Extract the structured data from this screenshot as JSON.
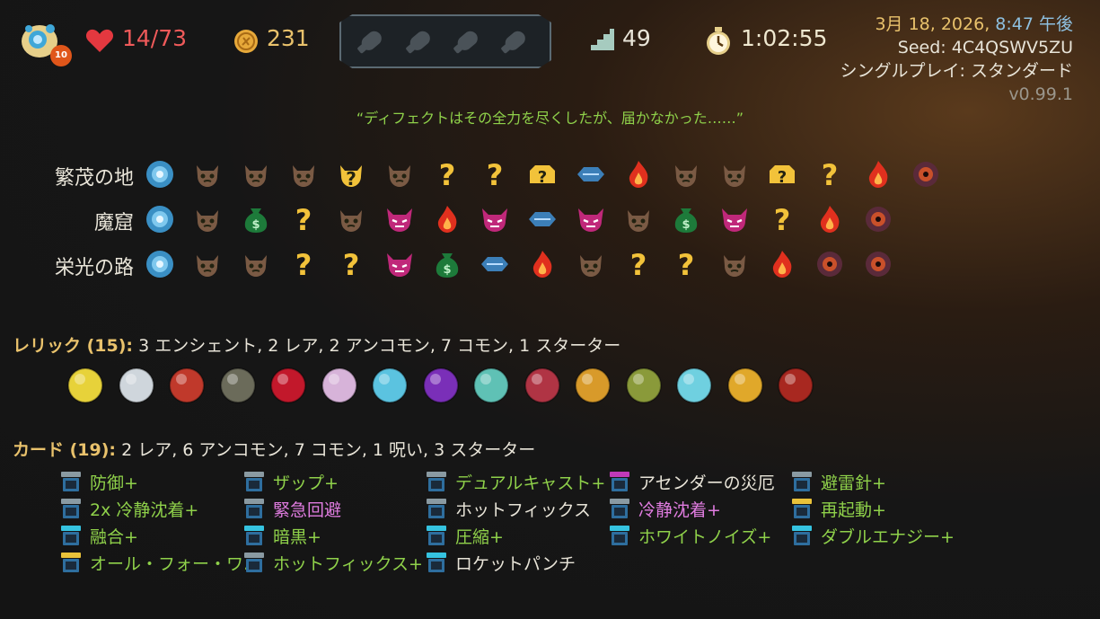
{
  "header": {
    "ascension": "10",
    "hp": "14/73",
    "gold": "231",
    "floor": "49",
    "time": "1:02:55",
    "date": "3月 18, 2026, ",
    "clock": "8:47 午後",
    "seed": "Seed: 4C4QSWV5ZU",
    "mode": "シングルプレイ: スタンダード",
    "version": "v0.99.1",
    "potion_slots": [
      "potion-slot-empty",
      "potion-slot-empty",
      "potion-slot-empty",
      "potion-slot-empty"
    ]
  },
  "quote": "“ディフェクトはその全力を尽くしたが、届かなかった……”",
  "acts": [
    {
      "label": "繁茂の地",
      "nodes": [
        "ancient",
        "monster",
        "monster",
        "monster",
        "unknown-monster",
        "monster",
        "unknown",
        "unknown",
        "unknown-treasure",
        "treasure",
        "rest",
        "monster",
        "monster",
        "unknown-treasure",
        "unknown",
        "rest",
        "boss"
      ]
    },
    {
      "label": "魔窟",
      "nodes": [
        "ancient",
        "monster",
        "shop",
        "unknown",
        "monster",
        "elite",
        "rest",
        "elite",
        "treasure",
        "elite",
        "monster",
        "shop",
        "elite",
        "unknown",
        "rest",
        "boss"
      ]
    },
    {
      "label": "栄光の路",
      "nodes": [
        "ancient",
        "monster",
        "monster",
        "unknown",
        "unknown",
        "elite",
        "shop",
        "treasure",
        "rest",
        "monster",
        "unknown",
        "unknown",
        "monster",
        "rest",
        "boss",
        "boss"
      ]
    }
  ],
  "relics": {
    "heading": "レリック (15):",
    "summary": " 3 エンシェント, 2 レア, 2 アンコモン, 7 コモン, 1 スターター",
    "items": [
      "lightning-orb",
      "glass-orb",
      "lipstick",
      "dragon-egg",
      "red-envelope",
      "worm",
      "ice-crystal",
      "purple-flame",
      "ticket",
      "anvil",
      "sunflower-pot",
      "fern",
      "gem-pendant",
      "golden-crown",
      "potion-flask"
    ]
  },
  "cards": {
    "heading": "カード (19):",
    "summary": " 2 レア, 6 アンコモン, 7 コモン, 1 呪い, 3 スターター",
    "items": [
      {
        "name": "防御+",
        "style": "up",
        "icon": "card-skill"
      },
      {
        "name": "2x 冷静沈着+",
        "style": "up",
        "icon": "card-skill"
      },
      {
        "name": "融合+",
        "style": "up",
        "icon": "card-skill-rare"
      },
      {
        "name": "オール・フォー・ワ…",
        "style": "up",
        "icon": "card-skill-gold"
      },
      {
        "name": "ザップ+",
        "style": "up",
        "icon": "card-skill"
      },
      {
        "name": "緊急回避",
        "style": "pink",
        "icon": "card-skill-blue"
      },
      {
        "name": "暗黒+",
        "style": "up",
        "icon": "card-skill-rare"
      },
      {
        "name": "ホットフィックス+",
        "style": "up",
        "icon": "card-skill"
      },
      {
        "name": "デュアルキャスト+",
        "style": "up",
        "icon": "card-skill"
      },
      {
        "name": "ホットフィックス",
        "style": "norm",
        "icon": "card-skill"
      },
      {
        "name": "圧縮+",
        "style": "up",
        "icon": "card-skill-rare"
      },
      {
        "name": "ロケットパンチ",
        "style": "norm",
        "icon": "card-skill-rare"
      },
      {
        "name": "アセンダーの災厄",
        "style": "norm",
        "icon": "card-curse"
      },
      {
        "name": "冷静沈着+",
        "style": "pink",
        "icon": "card-skill-white"
      },
      {
        "name": "ホワイトノイズ+",
        "style": "up",
        "icon": "card-skill-rare"
      },
      {
        "name": "避雷針+",
        "style": "up",
        "icon": "card-skill"
      },
      {
        "name": "再起動+",
        "style": "up",
        "icon": "card-skill-gold"
      },
      {
        "name": "ダブルエナジー+",
        "style": "up",
        "icon": "card-skill-rare"
      }
    ]
  }
}
